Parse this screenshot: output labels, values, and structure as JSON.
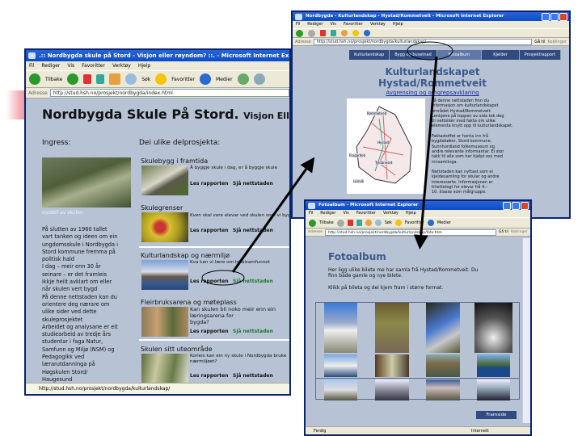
{
  "window_main": {
    "title": ".:: Nordbygda skule på Stord - Visjon eller røyndom? ::. - Microsoft Internet Explorer",
    "menu": [
      "Fil",
      "Rediger",
      "Vis",
      "Favoritter",
      "Verktøy",
      "Hjelp"
    ],
    "toolbar": {
      "back": "Tilbake",
      "search": "Søk",
      "favorites": "Favoritter",
      "media": "Medier"
    },
    "address_label": "Adresse",
    "address": "http://stud.hsh.no/prosjekt/nordbygda/index.html",
    "heading": "Nordbygda Skule På Stord.",
    "subheading": "Visjon Eller Røy",
    "ingress_label": "Ingress:",
    "projects_label": "Dei ulike delprosjekta:",
    "caption": "modell av skulen",
    "ingress_text": "På slutten av 1960 tallet\nvart tanken og ideen om ein\nungdomsskule i Nordbygda i\nStord kommune fremma på\npolitisk hald\nI dag – meir enn 30 år\nseinare – er det framleis\nikkje heilt avklart om eller\nnår skulen vert bygd\nPå denne nettstaden kan du\norientere deg nærare om\nulike sider ved dette\nskuleprosjektet\nArbeidet og analysane er eit\nstudiearbeid av tredje års\nstudentar i faga Natur,\nSamfunn og Miljø (NSM) og\nPedagogikk ved\nlærarutdanninga på\nHøgskulen Stord/\nHaugesund",
    "projects": [
      {
        "title": "Skulebygg i framtida",
        "desc": "Å byggje skule i dag, er å byggje skule",
        "read": "Les rapporten",
        "site": "Sjå nettstaden"
      },
      {
        "title": "Skulegrenser",
        "desc": "Kven skal vere elevar ved skulen som vi byg",
        "read": "Les rapporten",
        "site": "Sjå nettstaden"
      },
      {
        "title": "Kulturlandskap og nærmiljø",
        "desc": "Kva kan vi lære om lokalsamfunnet",
        "read": "Les rapporten",
        "site": "Sjå nettstaden"
      },
      {
        "title": "Fleirbruksarena og møteplass",
        "desc": "Kan skulen bli noko meir enn ein læringsarena for",
        "desc2": "bygda?",
        "read": "Les rapporten",
        "site": "Sjå nettstaden"
      },
      {
        "title": "Skulen sitt uteområde",
        "desc": "Korleis kan ein ny skule i Nordbygda bruke",
        "desc2": "nærmiljøet?",
        "read": "Les rapporten",
        "site": "Sjå nettstaden"
      }
    ],
    "status": "http://stud.hsh.no/prosjekt/nordbygda/kulturlandskap/"
  },
  "window_kultur": {
    "title": "Nordbygda - Kulturlandskap - Hystad/Rommetveit - Microsoft Internet Explorer",
    "menu": [
      "Fil",
      "Rediger",
      "Vis",
      "Favoritter",
      "Verktøy",
      "Hjelp"
    ],
    "address_label": "Adresse",
    "address": "http://stud.hsh.no/prosjekt/nordbygda/kulturlandskap/",
    "go": "Gå til",
    "links": "Koblinger",
    "nav": [
      "Kulturlandskap",
      "Bygg og busetnad",
      "Fotoalbum",
      "Kjelder",
      "Prosjektrapport"
    ],
    "heading1": "Kulturlandskapet",
    "heading2": "Hystad/Rommetveit",
    "sublink": "Avgrensing og omgrepsavklaring",
    "map_labels": [
      "Rommetveit",
      "Hystad",
      "Frugarden",
      "Tyldaneset",
      "Leirvik"
    ],
    "text": "På denne nettstaden finn du\ninformasjon om kulturlandskapet\nområdet Hystad/Rommetveit.\nLenkjene på toppen av sida tek deg\ntil nettsider med fakta om ulike\nelementa knytt opp til kulturlandskapet.\n\nFaktastoffet er henta inn frå\nbygdebøker, Stord kommune,\nSunnhordland folkemuseum og\nandre relevante informantar. Ei stor\ntakk til alle som har hjelpt oss med\ninnsamlinga.\n\nNettstaden kan nyttast som ei\nkjeldesamling for skular og andre\ninteresserte. Informasjonen er\ntilrettelagt for elevar frå 4.–\n10. klasse som målgruppe."
  },
  "window_foto": {
    "title": "Fotoalbum - Microsoft Internet Explorer",
    "menu": [
      "Fil",
      "Rediger",
      "Vis",
      "Favoritter",
      "Verktøy",
      "Hjelp"
    ],
    "toolbar": {
      "back": "Tilbake",
      "search": "Søk",
      "favorites": "Favoritter",
      "media": "Medier"
    },
    "address_label": "Adresse",
    "address": "http://stud.hsh.no/prosjekt/nordbygda/kulturlandskap/foto.htm",
    "go": "Gå til",
    "links": "Koblinger",
    "heading": "Fotoalbum",
    "intro1": "Her ligg ulike bilete me har samla frå Hystad/Rommetveit. Du",
    "intro2": "finn både gamle og nye bilete.",
    "intro3": "Klikk på bileta og dei kjem fram i større format.",
    "next": "Framside",
    "status": "Ferdig",
    "zone": "Internett"
  },
  "colors": {
    "ie_title": "#0b4cc4",
    "page_bg": "#b7c3d5",
    "nav": "#2f4b80",
    "heading_blue": "#3a5a8c"
  }
}
